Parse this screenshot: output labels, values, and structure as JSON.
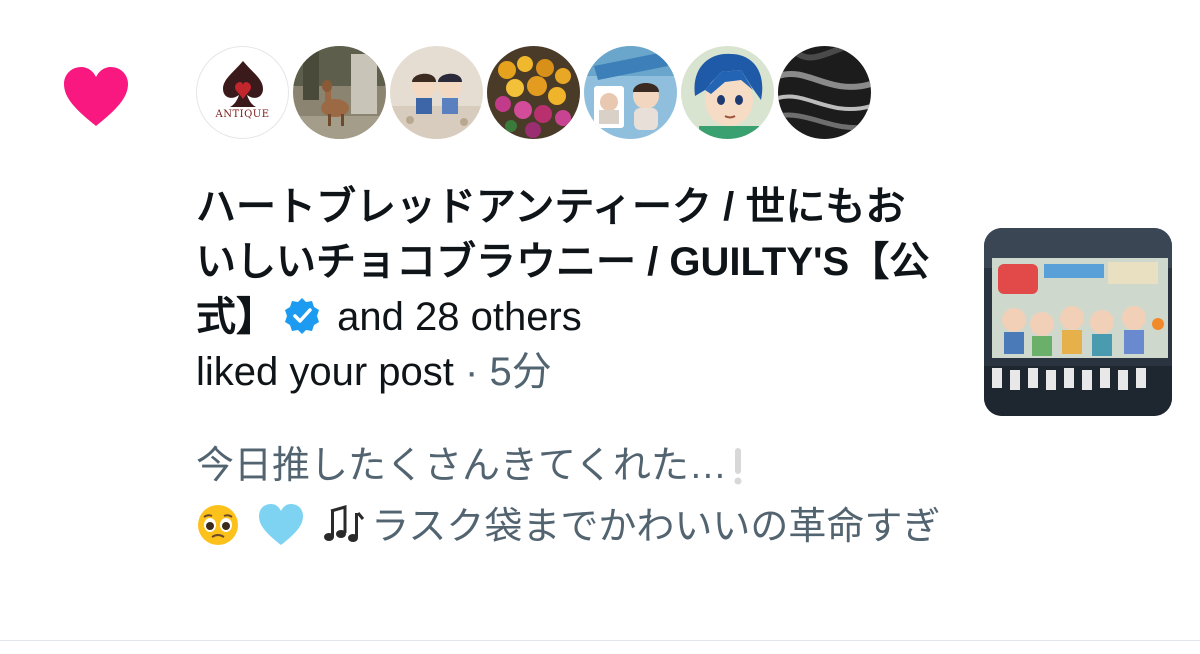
{
  "notification": {
    "type_icon": "heart-icon",
    "accent_color": "#f91880",
    "verified_color": "#1d9bf0",
    "avatars": [
      {
        "name": "avatar-heartbread-antique",
        "label": "ANTIQUE"
      },
      {
        "name": "avatar-deer"
      },
      {
        "name": "avatar-figures"
      },
      {
        "name": "avatar-flowers"
      },
      {
        "name": "avatar-photocards"
      },
      {
        "name": "avatar-anime-character"
      },
      {
        "name": "avatar-dark-abstract"
      }
    ],
    "account_name": "ハートブレッドアンティーク / 世にもおいしいチョコブラウニー / GUILTY'S【公式】",
    "others_text": "and 28 others",
    "action_text": "liked your post",
    "separator": "·",
    "timestamp": "5分",
    "post_line1": "今日推したくさんきてくれた…",
    "post_line2": "ラスク袋までかわいいの革命すぎ",
    "emojis": [
      "pleading-face-icon",
      "light-blue-heart-icon",
      "musical-notes-icon"
    ]
  }
}
